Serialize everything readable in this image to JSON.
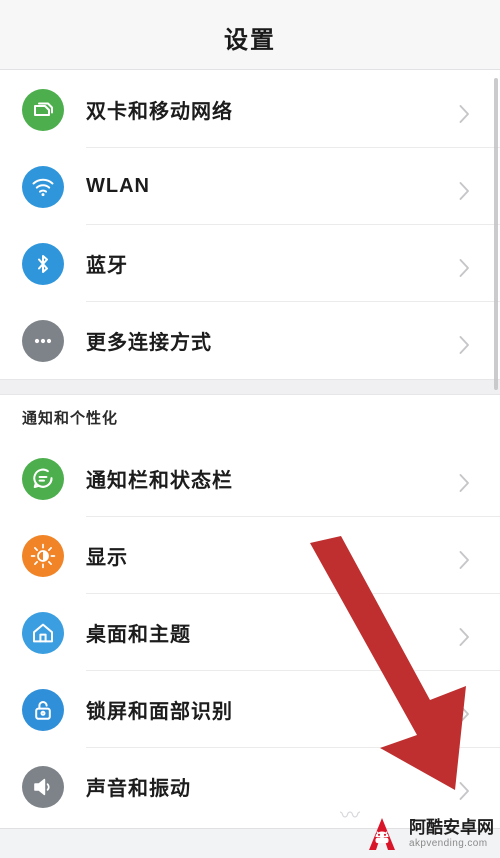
{
  "header": {
    "title": "设置"
  },
  "groups": [
    {
      "name": "connectivity",
      "label": "",
      "has_label": false,
      "rows": [
        {
          "label": "双卡和移动网络",
          "icon": "sim-card-icon",
          "icon_color": "#4cae4c",
          "chevron": "chevron-right-icon"
        },
        {
          "label": "WLAN",
          "icon": "wifi-icon",
          "icon_color": "#2f96dc",
          "chevron": "chevron-right-icon"
        },
        {
          "label": "蓝牙",
          "icon": "bluetooth-icon",
          "icon_color": "#2f96dc",
          "chevron": "chevron-right-icon"
        },
        {
          "label": "更多连接方式",
          "icon": "more-dots-icon",
          "icon_color": "#7d8388",
          "chevron": "chevron-right-icon"
        }
      ]
    },
    {
      "name": "notifications-personalization",
      "label": "通知和个性化",
      "has_label": true,
      "rows": [
        {
          "label": "通知栏和状态栏",
          "icon": "chat-bubble-icon",
          "icon_color": "#4cae4c",
          "chevron": "chevron-right-icon"
        },
        {
          "label": "显示",
          "icon": "brightness-icon",
          "icon_color": "#f08426",
          "chevron": "chevron-right-icon"
        },
        {
          "label": "桌面和主题",
          "icon": "home-icon",
          "icon_color": "#3a9ee0",
          "chevron": "chevron-right-icon"
        },
        {
          "label": "锁屏和面部识别",
          "icon": "unlock-icon",
          "icon_color": "#2f8fd8",
          "chevron": "chevron-right-icon"
        },
        {
          "label": "声音和振动",
          "icon": "speaker-icon",
          "icon_color": "#7d8388",
          "chevron": "chevron-right-icon"
        }
      ]
    }
  ],
  "annotation": {
    "name": "red-arrow",
    "color": "#bf2f2f",
    "direction": "down-right",
    "points_to": "声音和振动"
  },
  "scrollbar": {
    "name": "vertical-scrollbar",
    "color": "#c2c2c6"
  },
  "watermark": {
    "cn": "阿酷安卓网",
    "en": "akpvending.com",
    "logo": "letter-a-android-logo",
    "logo_color": "#d9152a"
  }
}
